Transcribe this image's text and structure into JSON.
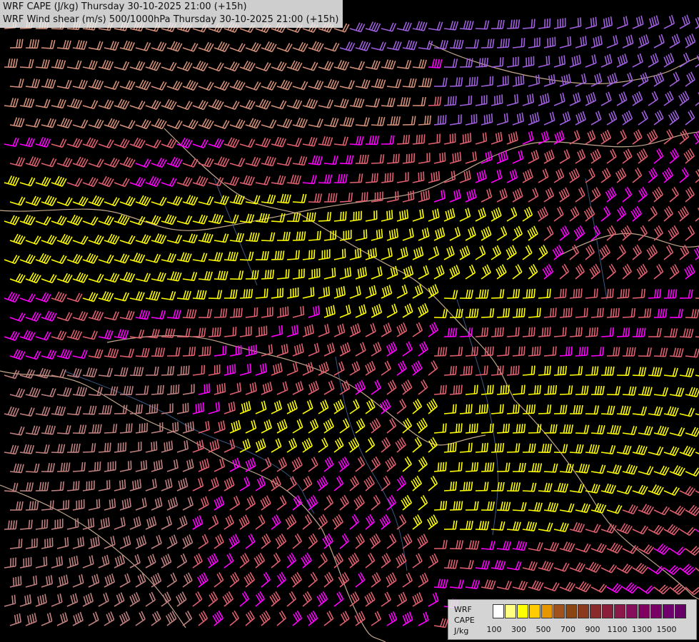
{
  "title": {
    "line1": "WRF CAPE (J/kg) Thursday 30-10-2025 21:00 (+15h)",
    "line2": "WRF Wind shear (m/s) 500/1000hPa Thursday 30-10-2025 21:00 (+15h)"
  },
  "legend": {
    "line1": "WRF",
    "line2": "CAPE",
    "line3": "J/kg",
    "swatch_colors": [
      "#ffffff",
      "#ffff80",
      "#ffff00",
      "#ffcc00",
      "#e69600",
      "#a0521e",
      "#8b4513",
      "#8c3a1e",
      "#8b2a2a",
      "#8b1e3a",
      "#8b1a4a",
      "#850f5a",
      "#800060",
      "#7a0066",
      "#700070",
      "#660066"
    ],
    "tick_labels": [
      "100",
      "300",
      "500",
      "700",
      "900",
      "1100",
      "1300",
      "1500"
    ]
  },
  "barb_colors": [
    "#ffff00",
    "#e06070",
    "#d4907a",
    "#ff00ff",
    "#cc60cc",
    "#a060e0",
    "#c08080",
    "#e8a0a0"
  ],
  "colors": {
    "background": "#000000",
    "border": "#d8b89a",
    "river": "#4a6fa5"
  }
}
